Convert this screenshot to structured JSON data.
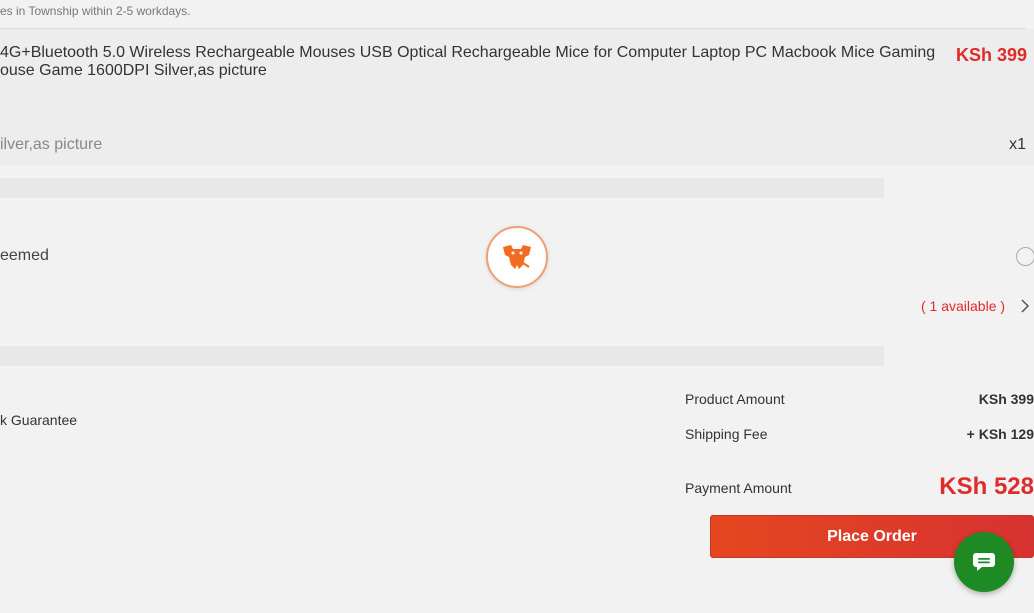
{
  "delivery": {
    "note": "es in Township within 2-5 workdays."
  },
  "product": {
    "title": "4G+Bluetooth 5.0 Wireless Rechargeable Mouses USB Optical Rechargeable Mice for Computer Laptop PC Macbook Mice Gaming ouse Game 1600DPI Silver,as picture",
    "price": "KSh 399",
    "variant": "ilver,as picture",
    "quantity": "x1"
  },
  "voucher": {
    "redeemed_label": "eemed",
    "available_text": "( 1 available )"
  },
  "guarantee": {
    "label": "k Guarantee"
  },
  "summary": {
    "product_amount_label": "Product Amount",
    "product_amount_value": "KSh 399",
    "shipping_fee_label": "Shipping Fee",
    "shipping_fee_value": "+ KSh 129",
    "payment_amount_label": "Payment Amount",
    "payment_amount_value": "KSh 528"
  },
  "actions": {
    "place_order_label": "Place Order"
  },
  "colors": {
    "accent_red": "#e02b2b",
    "chat_green": "#1e8a24",
    "loader_orange": "#f26b21"
  },
  "icons": {
    "loader": "elephant-mascot-icon",
    "chat": "chat-bubble-icon",
    "chevron": "chevron-right-icon"
  }
}
